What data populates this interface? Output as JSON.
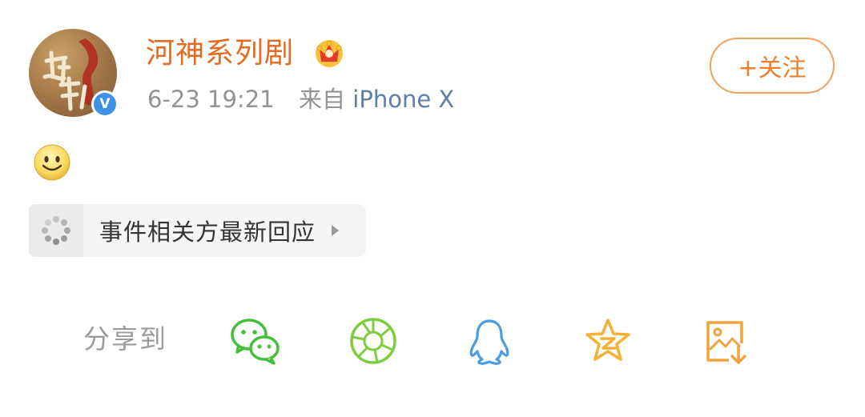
{
  "post": {
    "user_name": "河神系列剧",
    "date": "6-23 19:21",
    "source_prefix": "来自",
    "source": "iPhone X",
    "follow_label": "+关注"
  },
  "topic": {
    "title": "事件相关方最新回应"
  },
  "share": {
    "label": "分享到",
    "targets": [
      "wechat-icon",
      "moments-icon",
      "qq-icon",
      "qzone-icon",
      "save-image-icon"
    ]
  },
  "colors": {
    "username": "#e36a1f",
    "follow": "#ed7f2c",
    "meta": "#939393",
    "source": "#5d7ea7",
    "wechat": "#45c03c",
    "moments": "#7dcc3f",
    "qq": "#4a9de0",
    "qzone": "#f3b233",
    "save": "#f1a33c"
  }
}
